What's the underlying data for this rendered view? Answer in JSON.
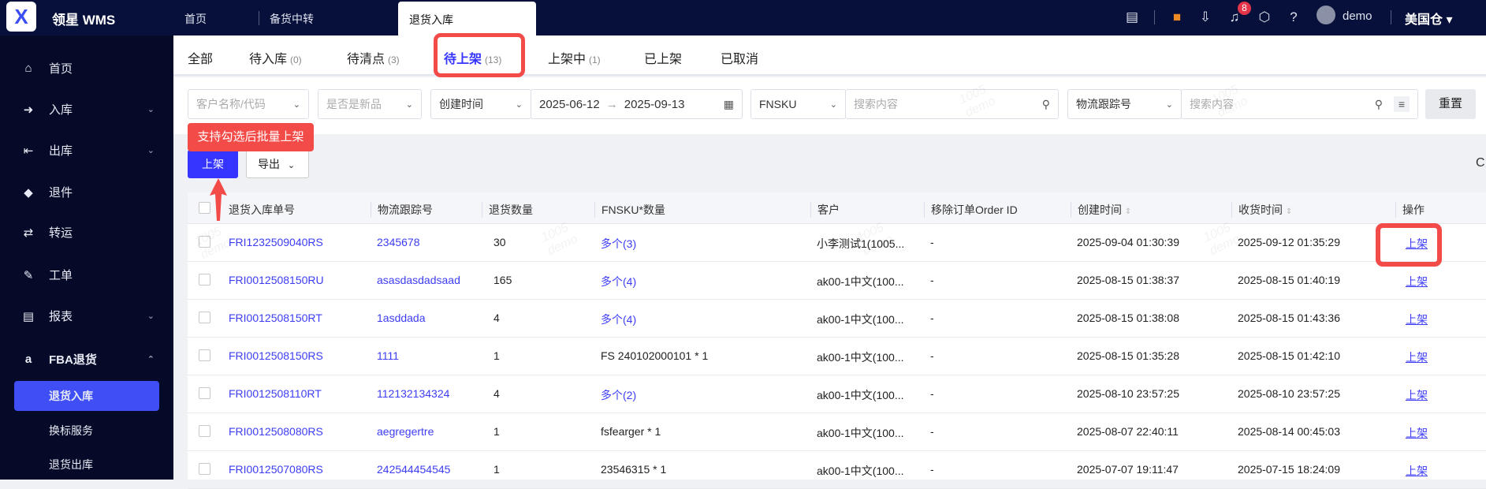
{
  "app": {
    "brand": "领星 WMS",
    "logo_glyph": "X"
  },
  "page_tabs": [
    {
      "label": "首页"
    },
    {
      "label": "备货中转"
    },
    {
      "label": "退货入库",
      "active": true
    }
  ],
  "header": {
    "notification_count": "8",
    "username": "demo",
    "warehouse": "美国仓"
  },
  "sidebar": {
    "items": [
      {
        "label": "首页",
        "icon": "home-icon"
      },
      {
        "label": "入库",
        "icon": "inbound-icon",
        "expandable": true
      },
      {
        "label": "出库",
        "icon": "outbound-icon",
        "expandable": true
      },
      {
        "label": "退件",
        "icon": "return-icon"
      },
      {
        "label": "转运",
        "icon": "transfer-icon"
      },
      {
        "label": "工单",
        "icon": "workorder-icon"
      },
      {
        "label": "报表",
        "icon": "report-icon",
        "expandable": true
      },
      {
        "label": "FBA退货",
        "icon": "amazon-icon",
        "expanded": true
      }
    ],
    "sub_items": [
      {
        "label": "退货入库",
        "active": true
      },
      {
        "label": "换标服务"
      },
      {
        "label": "退货出库"
      }
    ]
  },
  "status_tabs": [
    {
      "label": "全部",
      "count": ""
    },
    {
      "label": "待入库",
      "count": "(0)"
    },
    {
      "label": "待清点",
      "count": "(3)"
    },
    {
      "label": "待上架",
      "count": "(13)",
      "active": true
    },
    {
      "label": "上架中",
      "count": "(1)"
    },
    {
      "label": "已上架",
      "count": ""
    },
    {
      "label": "已取消",
      "count": ""
    }
  ],
  "filters": {
    "customer_placeholder": "客户名称/代码",
    "new_product_placeholder": "是否是新品",
    "date_type": "创建时间",
    "date_start": "2025-06-12",
    "date_end": "2025-09-13",
    "sku_type": "FNSKU",
    "sku_placeholder": "搜索内容",
    "tracking_type": "物流跟踪号",
    "tracking_placeholder": "搜索内容",
    "reset_label": "重置"
  },
  "toolbar": {
    "putaway_label": "上架",
    "export_label": "导出",
    "tip": "支持勾选后批量上架"
  },
  "table": {
    "columns": [
      "退货入库单号",
      "物流跟踪号",
      "退货数量",
      "FNSKU*数量",
      "客户",
      "移除订单Order ID",
      "创建时间",
      "收货时间",
      "操作"
    ],
    "rows": [
      [
        "FRI1232509040RS",
        "2345678",
        "30",
        "多个(3)",
        "小李测试1(1005...",
        "-",
        "2025-09-04 01:30:39",
        "2025-09-12 01:35:29",
        "上架"
      ],
      [
        "FRI0012508150RU",
        "asasdasdadsaad",
        "165",
        "多个(4)",
        "ak00-1中文(100...",
        "-",
        "2025-08-15 01:38:37",
        "2025-08-15 01:40:19",
        "上架"
      ],
      [
        "FRI0012508150RT",
        "1asddada",
        "4",
        "多个(4)",
        "ak00-1中文(100...",
        "-",
        "2025-08-15 01:38:08",
        "2025-08-15 01:43:36",
        "上架"
      ],
      [
        "FRI0012508150RS",
        "1111",
        "1",
        "FS 240102000101 * 1",
        "ak00-1中文(100...",
        "-",
        "2025-08-15 01:35:28",
        "2025-08-15 01:42:10",
        "上架"
      ],
      [
        "FRI0012508110RT",
        "112132134324",
        "4",
        "多个(2)",
        "ak00-1中文(100...",
        "-",
        "2025-08-10 23:57:25",
        "2025-08-10 23:57:25",
        "上架"
      ],
      [
        "FRI0012508080RS",
        "aegregertre",
        "1",
        "fsfearger * 1",
        "ak00-1中文(100...",
        "-",
        "2025-08-07 22:40:11",
        "2025-08-14 00:45:03",
        "上架"
      ],
      [
        "FRI0012507080RS",
        "242544454545",
        "1",
        "23546315 * 1",
        "ak00-1中文(100...",
        "-",
        "2025-07-07 19:11:47",
        "2025-07-15 18:24:09",
        "上架"
      ]
    ]
  },
  "watermark": "1005 demo",
  "colors": {
    "accent": "#3d3df5",
    "annotation": "#f24b48",
    "topbar": "#07103a"
  }
}
